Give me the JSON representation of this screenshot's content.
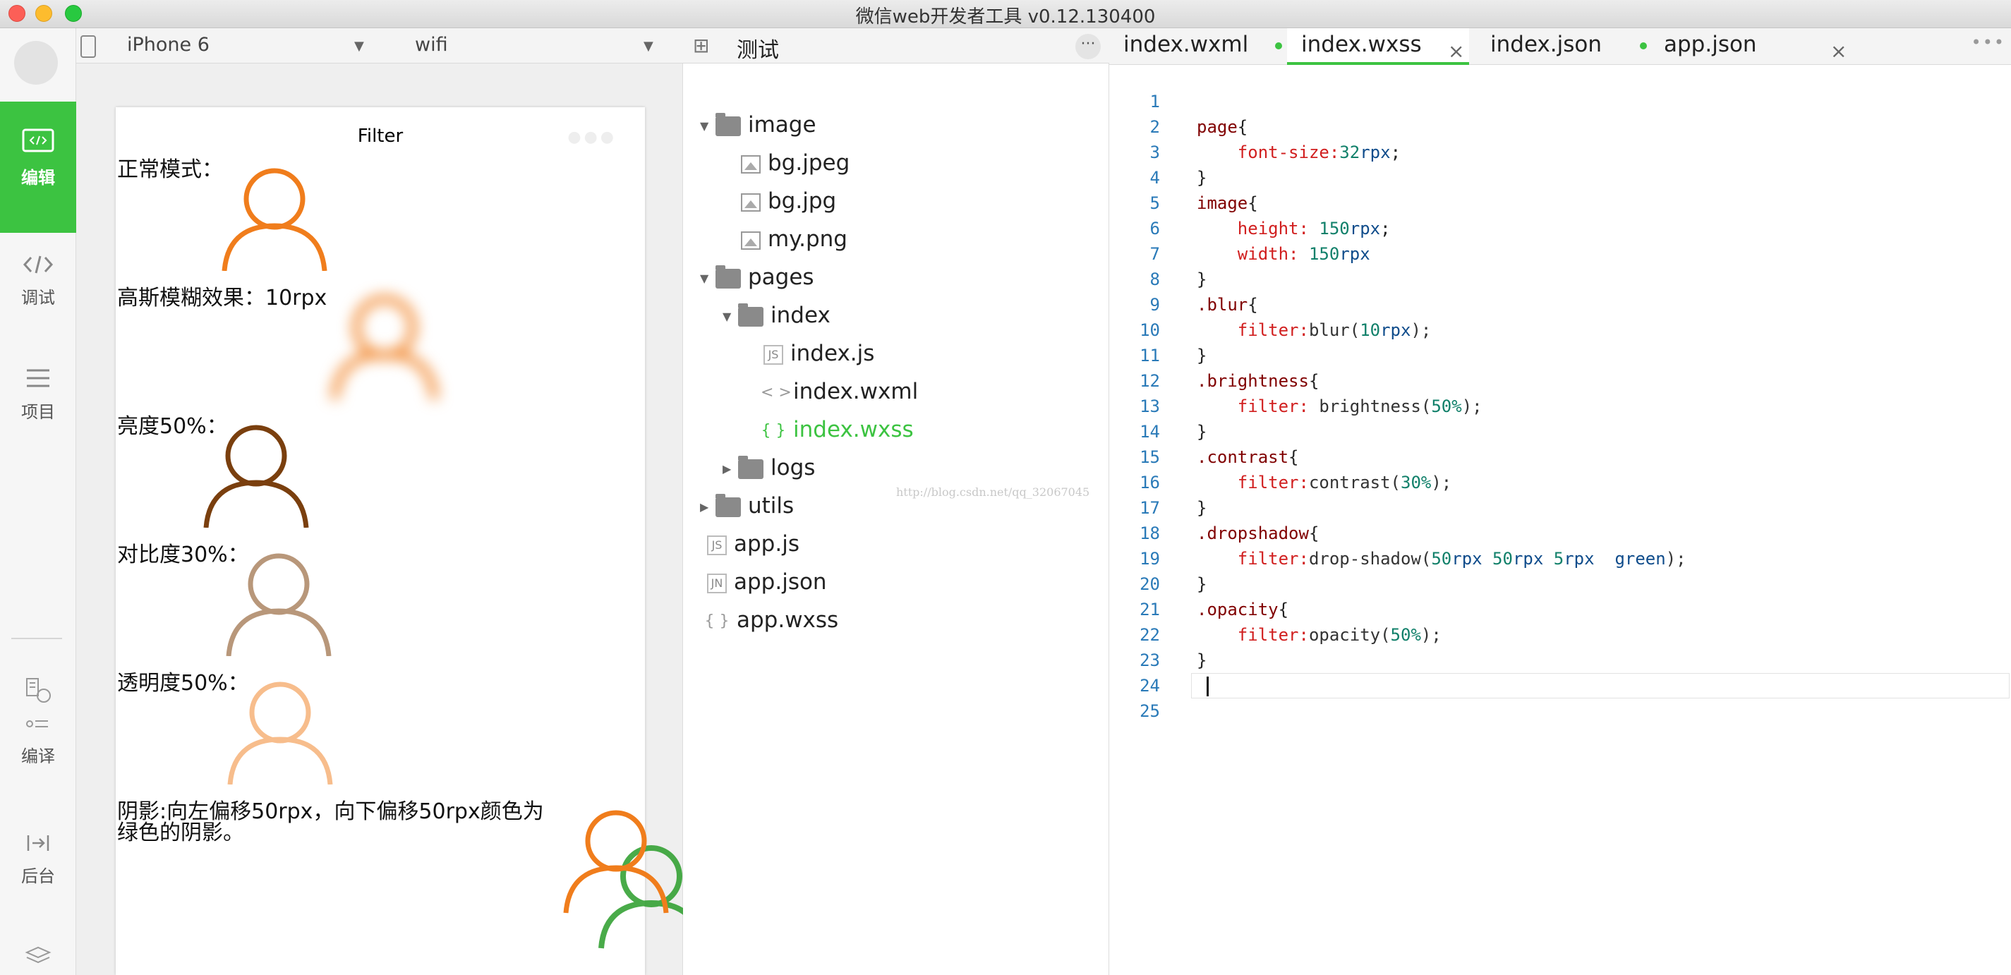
{
  "window": {
    "title": "微信web开发者工具 v0.12.130400"
  },
  "sidebar": {
    "items": [
      {
        "label": "编辑",
        "icon": "code-box-icon",
        "active": true
      },
      {
        "label": "调试",
        "icon": "code-brackets-icon"
      },
      {
        "label": "项目",
        "icon": "list-icon"
      },
      {
        "label": "编译",
        "icon": "compile-icon"
      },
      {
        "label": "后台",
        "icon": "backend-icon"
      }
    ]
  },
  "simulator": {
    "device": "iPhone 6",
    "network": "wifi",
    "page_title": "Filter",
    "rows": [
      {
        "label": "正常模式：",
        "effect": "normal"
      },
      {
        "label": "高斯模糊效果：10rpx",
        "effect": "blur"
      },
      {
        "label": "亮度50%：",
        "effect": "brightness"
      },
      {
        "label": "对比度30%：",
        "effect": "contrast"
      },
      {
        "label": "透明度50%：",
        "effect": "opacity"
      },
      {
        "label": "阴影:向左偏移50rpx，向下偏移50rpx颜色为绿色的阴影。",
        "label_line1": "阴影:向左偏移50rpx，向下偏移50rpx颜色为",
        "label_line2": "绿色的阴影。",
        "effect": "dropshadow"
      }
    ]
  },
  "file_tree": {
    "project_name": "测试",
    "nodes": [
      {
        "label": "image",
        "type": "folder",
        "expanded": true
      },
      {
        "label": "bg.jpeg",
        "type": "image"
      },
      {
        "label": "bg.jpg",
        "type": "image"
      },
      {
        "label": "my.png",
        "type": "image"
      },
      {
        "label": "pages",
        "type": "folder",
        "expanded": true
      },
      {
        "label": "index",
        "type": "folder",
        "expanded": true
      },
      {
        "label": "index.js",
        "type": "js",
        "badge": "JS"
      },
      {
        "label": "index.wxml",
        "type": "wxml",
        "badge": "< >"
      },
      {
        "label": "index.wxss",
        "type": "wxss",
        "badge": "{ }",
        "active": true
      },
      {
        "label": "logs",
        "type": "folder",
        "expanded": false
      },
      {
        "label": "utils",
        "type": "folder",
        "expanded": false
      },
      {
        "label": "app.js",
        "type": "js",
        "badge": "JS"
      },
      {
        "label": "app.json",
        "type": "json",
        "badge": "JN"
      },
      {
        "label": "app.wxss",
        "type": "wxss",
        "badge": "{ }"
      }
    ]
  },
  "editor": {
    "tabs": [
      {
        "label": "index.wxml",
        "modified": true
      },
      {
        "label": "index.wxss",
        "active": true,
        "close": "×"
      },
      {
        "label": "index.json",
        "modified": true
      },
      {
        "label": "app.json",
        "close": "×"
      }
    ],
    "watermark": "http://blog.csdn.net/qq_32067045",
    "line_numbers": [
      "1",
      "2",
      "3",
      "4",
      "5",
      "6",
      "7",
      "8",
      "9",
      "10",
      "11",
      "12",
      "13",
      "14",
      "15",
      "16",
      "17",
      "18",
      "19",
      "20",
      "21",
      "22",
      "23",
      "24",
      "25"
    ],
    "lines": [
      [],
      [
        [
          "sel",
          "page"
        ],
        [
          "brace",
          "{"
        ]
      ],
      [
        [
          "prop",
          "    font-size:"
        ],
        [
          "num",
          "32"
        ],
        [
          "unit",
          "rpx"
        ],
        [
          "brace",
          ";"
        ]
      ],
      [
        [
          "brace",
          "}"
        ]
      ],
      [
        [
          "sel",
          "image"
        ],
        [
          "brace",
          "{"
        ]
      ],
      [
        [
          "prop",
          "    height: "
        ],
        [
          "num",
          "150"
        ],
        [
          "unit",
          "rpx"
        ],
        [
          "brace",
          ";"
        ]
      ],
      [
        [
          "prop",
          "    width: "
        ],
        [
          "num",
          "150"
        ],
        [
          "unit",
          "rpx"
        ]
      ],
      [
        [
          "brace",
          "}"
        ]
      ],
      [
        [
          "sel",
          ".blur"
        ],
        [
          "brace",
          "{"
        ]
      ],
      [
        [
          "prop",
          "    filter:"
        ],
        [
          "fn",
          "blur("
        ],
        [
          "num",
          "10"
        ],
        [
          "unit",
          "rpx"
        ],
        [
          "fn",
          ");"
        ]
      ],
      [
        [
          "brace",
          "}"
        ]
      ],
      [
        [
          "sel",
          ".brightness"
        ],
        [
          "brace",
          "{"
        ]
      ],
      [
        [
          "prop",
          "    filter: "
        ],
        [
          "fn",
          "brightness("
        ],
        [
          "num",
          "50%"
        ],
        [
          "fn",
          ");"
        ]
      ],
      [
        [
          "brace",
          "}"
        ]
      ],
      [
        [
          "sel",
          ".contrast"
        ],
        [
          "brace",
          "{"
        ]
      ],
      [
        [
          "prop",
          "    filter:"
        ],
        [
          "fn",
          "contrast("
        ],
        [
          "num",
          "30%"
        ],
        [
          "fn",
          ");"
        ]
      ],
      [
        [
          "brace",
          "}"
        ]
      ],
      [
        [
          "sel",
          ".dropshadow"
        ],
        [
          "brace",
          "{"
        ]
      ],
      [
        [
          "prop",
          "    filter:"
        ],
        [
          "fn",
          "drop-shadow("
        ],
        [
          "num",
          "50"
        ],
        [
          "unit",
          "rpx "
        ],
        [
          "num",
          "50"
        ],
        [
          "unit",
          "rpx "
        ],
        [
          "num",
          "5"
        ],
        [
          "unit",
          "rpx  green"
        ],
        [
          "fn",
          ");"
        ]
      ],
      [
        [
          "brace",
          "}"
        ]
      ],
      [
        [
          "sel",
          ".opacity"
        ],
        [
          "brace",
          "{"
        ]
      ],
      [
        [
          "prop",
          "    filter:"
        ],
        [
          "fn",
          "opacity("
        ],
        [
          "num",
          "50%"
        ],
        [
          "fn",
          ");"
        ]
      ],
      [
        [
          "brace",
          "}"
        ]
      ],
      [],
      []
    ]
  },
  "colors": {
    "accent": "#3cc341",
    "person_orange": "#f07d1c",
    "shadow_green": "#2a9d2a"
  }
}
